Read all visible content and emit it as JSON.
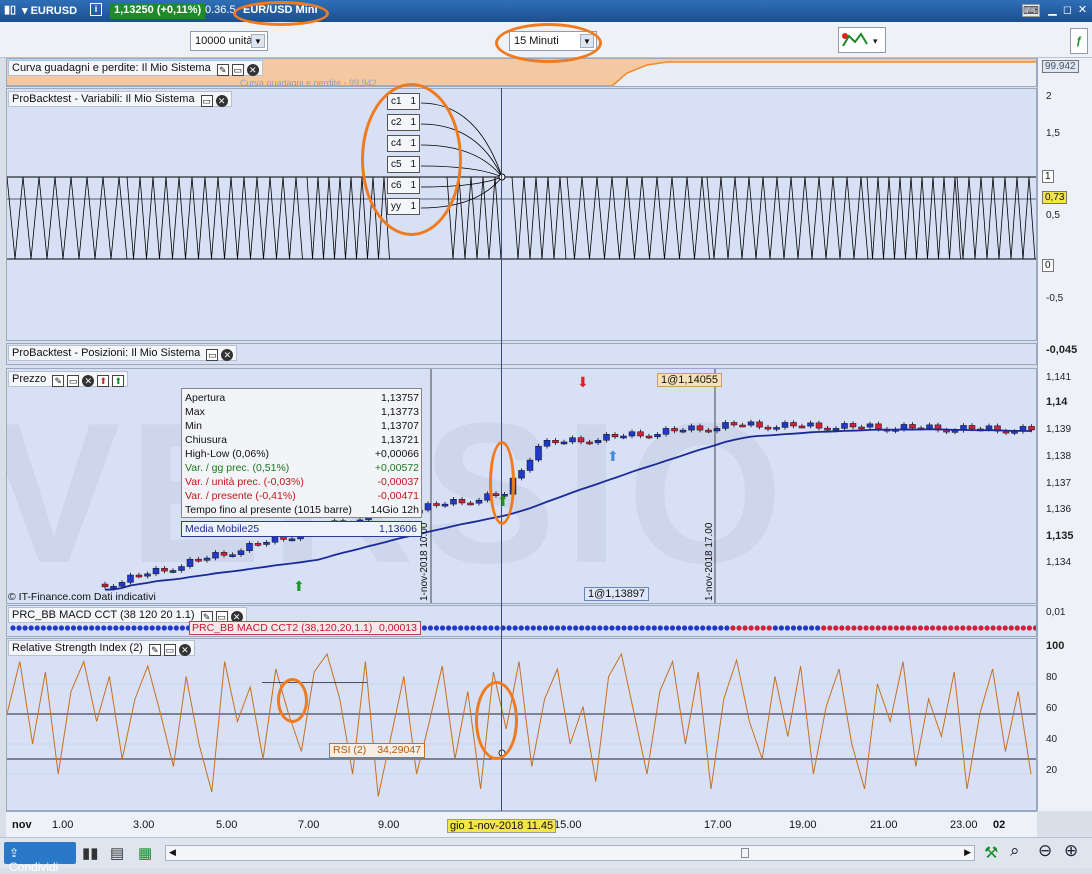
{
  "titlebar": {
    "symbol": "EURUSD",
    "price": "1,13250 (+0,11%)",
    "extra": "0.36.5",
    "chart_name": "EUR/USD Mini"
  },
  "toolbar": {
    "units": "10000 unità",
    "timeframe": "15 Minuti"
  },
  "panels": {
    "equity": {
      "title": "Curva guadagni e perdite: Il Mio Sistema",
      "legend": "Curva guadagni e perdite - 99,942",
      "value": "99.942"
    },
    "variables": {
      "title": "ProBacktest - Variabili: Il Mio Sistema",
      "vars": [
        {
          "name": "c1",
          "val": "1"
        },
        {
          "name": "c2",
          "val": "1"
        },
        {
          "name": "c4",
          "val": "1"
        },
        {
          "name": "c5",
          "val": "1"
        },
        {
          "name": "c6",
          "val": "1"
        },
        {
          "name": "yy",
          "val": "1"
        }
      ],
      "scale": [
        "2",
        "1,5",
        "1",
        "0,73",
        "0,5",
        "0",
        "-0,5"
      ]
    },
    "positions": {
      "title": "ProBacktest - Posizioni: Il Mio Sistema",
      "value": "-0,045"
    },
    "price": {
      "title": "Prezzo",
      "order_top": "1@1,14055",
      "order_bottom": "1@1,13897",
      "watermark": "VERSIO",
      "copyright": "© IT-Finance.com Dati indicativi",
      "vline1": "1-nov-2018 10.00",
      "vline2": "1-nov-2018 17.00",
      "scale": [
        "1,141",
        "1,14",
        "1,139",
        "1,138",
        "1,137",
        "1,136",
        "1,135",
        "1,134"
      ]
    },
    "macd": {
      "title": "PRC_BB MACD CCT (38 120 20 1.1)",
      "legend": "PRC_BB MACD CCT2 (38,120,20,1.1)",
      "legend_val": "0,00013",
      "scale": "0,01"
    },
    "rsi": {
      "title": "Relative Strength Index (2)",
      "legend": "RSI (2)",
      "legend_val": "34,29047",
      "scale": [
        "100",
        "80",
        "60",
        "40",
        "20"
      ]
    }
  },
  "infobox": [
    {
      "label": "Apertura",
      "value": "1,13757",
      "color": "#111"
    },
    {
      "label": "Max",
      "value": "1,13773",
      "color": "#111"
    },
    {
      "label": "Min",
      "value": "1,13707",
      "color": "#111"
    },
    {
      "label": "Chiusura",
      "value": "1,13721",
      "color": "#111"
    },
    {
      "label": "High-Low (0,06%)",
      "value": "+0,00066",
      "color": "#111"
    },
    {
      "label": "Var. / gg prec. (0,51%)",
      "value": "+0,00572",
      "color": "#1e7a1e"
    },
    {
      "label": "Var. / unità prec. (-0,03%)",
      "value": "-0,00037",
      "color": "#c01818"
    },
    {
      "label": "Var. / presente (-0,41%)",
      "value": "-0,00471",
      "color": "#c01818"
    },
    {
      "label": "Tempo fino al presente (1015 barre)",
      "value": "14Gio 12h",
      "color": "#111"
    }
  ],
  "ma_label": {
    "name": "Media Mobile25",
    "value": "1,13606"
  },
  "xaxis": {
    "labels": [
      "nov",
      "1.00",
      "3.00",
      "5.00",
      "7.00",
      "9.00",
      "gio 1-nov-2018 11.45",
      "15.00",
      "17.00",
      "19.00",
      "21.00",
      "23.00",
      "02"
    ],
    "highlight": "gio 1-nov-2018 11.45"
  },
  "bottom": {
    "share": "Condividi"
  },
  "colors": {
    "up": "#2139c8",
    "down": "#d0203a",
    "ma": "#1a2a9a",
    "rsi": "#c87020",
    "accent": "#f07a1e"
  }
}
